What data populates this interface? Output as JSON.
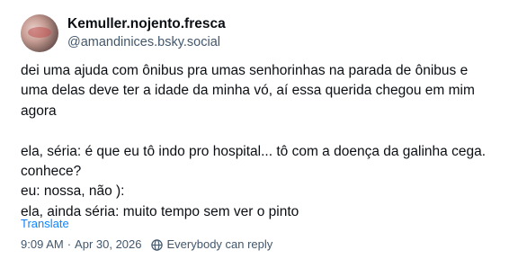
{
  "post": {
    "display_name": "Kemuller.nojento.fresca",
    "handle": "@amandinices.bsky.social",
    "text": "dei uma ajuda com ônibus pra umas senhorinhas na parada de ônibus e uma delas deve ter a idade da minha vó, aí essa querida chegou em mim agora\n\nela, séria: é que eu tô indo pro hospital... tô com a doença da galinha cega. conhece?\neu: nossa, não ):\nela, ainda séria: muito tempo sem ver o pinto",
    "translate_label": "Translate",
    "time": "9:09 AM",
    "separator": "·",
    "date": "Apr 30, 2026",
    "reply_setting": "Everybody can reply",
    "reply_icon": "globe-reply-icon"
  },
  "colors": {
    "text": "#0b0f14",
    "muted": "#42576c",
    "link": "#1083fe"
  }
}
